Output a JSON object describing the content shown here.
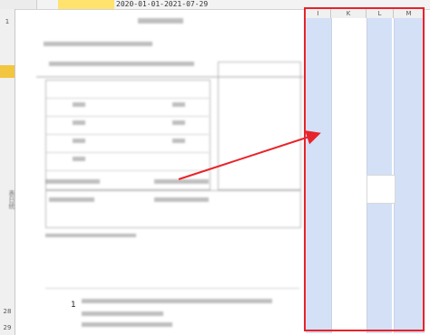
{
  "toolbar": {
    "formula_text": "2020-01-01-2021-07-29"
  },
  "columns": {
    "headers": [
      "I",
      "K",
      "L",
      "M"
    ]
  },
  "rows": {
    "numbers": [
      "1",
      "",
      "",
      "",
      "",
      "",
      "",
      "",
      "",
      "",
      "",
      "",
      "",
      "",
      "",
      "",
      "",
      "",
      "",
      "",
      "",
      "",
      "",
      "",
      "",
      "",
      "",
      "28",
      "29"
    ]
  },
  "document": {
    "side_label": "表日统",
    "sub_date": "01-",
    "footnote_marker": "1"
  },
  "colors": {
    "highlight_column": "#d3e0f6",
    "annotation_red": "#e8232a",
    "formula_highlight": "#ffe36e",
    "row_highlight": "#f3c63f"
  }
}
